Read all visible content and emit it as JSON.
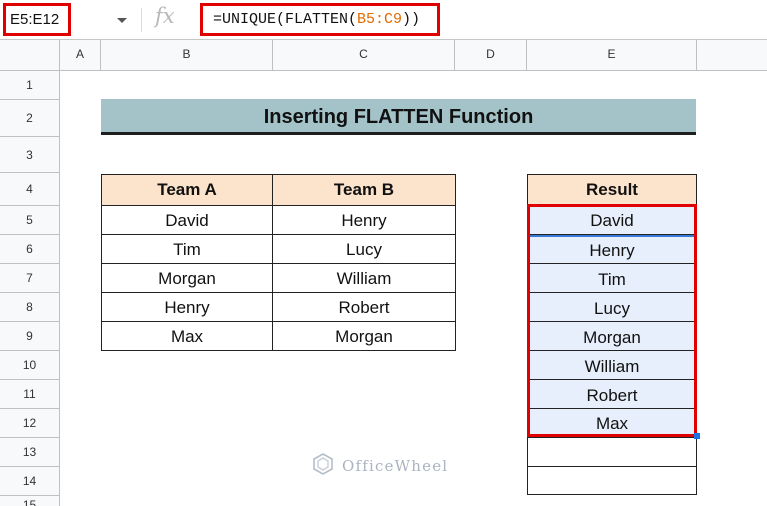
{
  "formula_bar": {
    "name_box": "E5:E12",
    "fx_label": "fx",
    "formula_prefix": "=UNIQUE(FLATTEN(",
    "formula_range": "B5:C9",
    "formula_suffix": "))"
  },
  "columns": [
    "A",
    "B",
    "C",
    "D",
    "E"
  ],
  "rows": [
    "1",
    "2",
    "3",
    "4",
    "5",
    "6",
    "7",
    "8",
    "9",
    "10",
    "11",
    "12",
    "13",
    "14",
    "15"
  ],
  "title": "Inserting FLATTEN Function",
  "table": {
    "headers": [
      "Team A",
      "Team B"
    ],
    "rows": [
      [
        "David",
        "Henry"
      ],
      [
        "Tim",
        "Lucy"
      ],
      [
        "Morgan",
        "William"
      ],
      [
        "Henry",
        "Robert"
      ],
      [
        "Max",
        "Morgan"
      ]
    ]
  },
  "result": {
    "header": "Result",
    "values": [
      "David",
      "Henry",
      "Tim",
      "Lucy",
      "Morgan",
      "William",
      "Robert",
      "Max"
    ]
  },
  "watermark": "OfficeWheel",
  "colors": {
    "highlight_red": "#e00000",
    "banner_bg": "#a3c3c8",
    "header_bg": "#fce3cb",
    "result_bg": "#e6effb",
    "selection_blue": "#1a73e8"
  }
}
